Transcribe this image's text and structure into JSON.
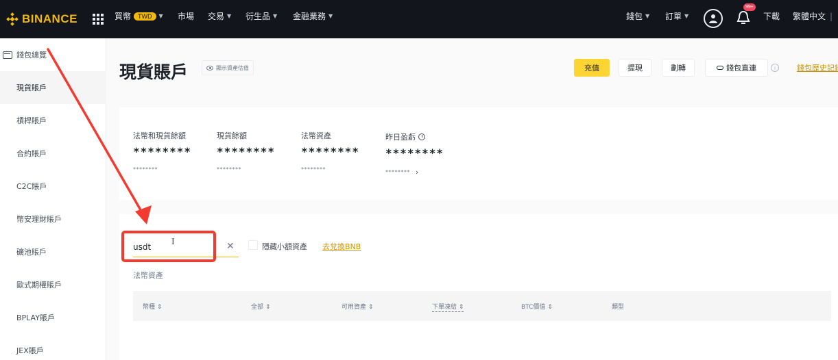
{
  "topbar": {
    "logo_text": "BINANCE",
    "nav": [
      {
        "label": "買幣",
        "badge": "TWD",
        "dropdown": true
      },
      {
        "label": "市場",
        "dropdown": false
      },
      {
        "label": "交易",
        "dropdown": true
      },
      {
        "label": "衍生品",
        "dropdown": true
      },
      {
        "label": "金融業務",
        "dropdown": true
      }
    ],
    "right": {
      "wallet": "錢包",
      "orders": "訂單",
      "notification_count": "99+",
      "download": "下載",
      "language": "繁體中文",
      "divider": "|"
    },
    "colors": {
      "bg": "#12161c",
      "brand": "#f0b90b"
    }
  },
  "sidebar": {
    "overview": "錢包總覽",
    "items": [
      "現貨賬戶",
      "槓桿賬戶",
      "合約賬戶",
      "C2C賬戶",
      "幣安理財賬戶",
      "礦池賬戶",
      "歐式期權賬戶",
      "BPLAY賬戶",
      "JEX賬戶"
    ],
    "active_index": 0
  },
  "header": {
    "title": "現貨賬戶",
    "show_values": "顯示資產估值",
    "buttons": {
      "deposit": "充值",
      "withdraw": "提現",
      "transfer": "劃轉",
      "wallet_direct": "錢包直連"
    },
    "history_link": "錢包歷史記錄"
  },
  "balances": [
    {
      "label": "法幣和現貨餘額",
      "value": "********",
      "sub": "********"
    },
    {
      "label": "現貨餘額",
      "value": "********",
      "sub": "********"
    },
    {
      "label": "法幣資產",
      "value": "********",
      "sub": "********"
    },
    {
      "label": "昨日盈虧",
      "value": "********",
      "sub": "********",
      "has_info": true,
      "has_chevron": true
    }
  ],
  "assets": {
    "search_value": "usdt",
    "hide_small": "隱藏小額資產",
    "convert_bnb": "去兌換BNB",
    "section": "法幣資產",
    "columns": [
      "幣種",
      "全部",
      "可用資產",
      "下單凍結",
      "BTC價值",
      "類型"
    ],
    "sortable": [
      true,
      true,
      true,
      true,
      true,
      false
    ]
  },
  "annotation": {
    "color": "#f23b30"
  }
}
